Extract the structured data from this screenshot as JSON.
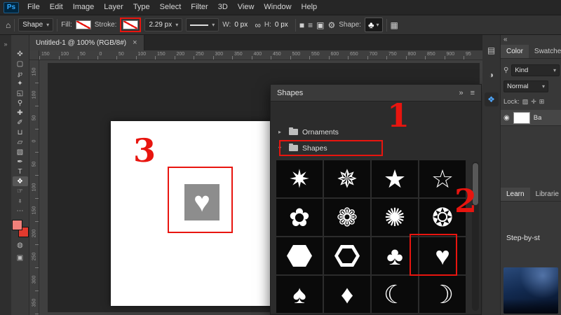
{
  "colors": {
    "annotation_red": "#e8150f",
    "logo_blue": "#31a8ff",
    "panel_active_blue": "#4fa8ff",
    "canvas_shape_gray": "#8d8d8d",
    "foreground_swatch": "#f0807a",
    "background_swatch": "#e23a2e"
  },
  "menu_bar": {
    "logo": "Ps",
    "items": [
      "File",
      "Edit",
      "Image",
      "Layer",
      "Type",
      "Select",
      "Filter",
      "3D",
      "View",
      "Window",
      "Help"
    ]
  },
  "options_bar": {
    "home_icon": "⌂",
    "tool_mode_value": "Shape",
    "chevron": "▾",
    "fill_label": "Fill:",
    "stroke_label": "Stroke:",
    "stroke_width_value": "2.29 px",
    "w_label": "W:",
    "w_value": "0 px",
    "link_icon": "∞",
    "h_label": "H:",
    "h_value": "0 px",
    "path_ops_icon": "■",
    "align_icon": "≡",
    "arrange_icon": "▣",
    "gear_icon": "⚙",
    "shape_label": "Shape:",
    "shape_preview_icon": "♣",
    "extra_icon": "▦"
  },
  "left_dock": {
    "expand_icon": "»"
  },
  "tools": [
    {
      "name": "move-tool",
      "glyph": "✜"
    },
    {
      "name": "rectangular-marquee-tool",
      "glyph": "▢"
    },
    {
      "name": "lasso-tool",
      "glyph": "℘"
    },
    {
      "name": "quick-selection-tool",
      "glyph": "✦"
    },
    {
      "name": "crop-tool",
      "glyph": "◱"
    },
    {
      "name": "eyedropper-tool",
      "glyph": "⚲"
    },
    {
      "name": "spot-healing-brush-tool",
      "glyph": "✚"
    },
    {
      "name": "brush-tool",
      "glyph": "✐"
    },
    {
      "name": "clone-stamp-tool",
      "glyph": "⊔"
    },
    {
      "name": "eraser-tool",
      "glyph": "▱"
    },
    {
      "name": "gradient-tool",
      "glyph": "▧"
    },
    {
      "name": "pen-tool",
      "glyph": "✒"
    },
    {
      "name": "type-tool",
      "glyph": "T"
    },
    {
      "name": "custom-shape-tool",
      "glyph": "❖",
      "active": true
    },
    {
      "name": "hand-tool",
      "glyph": "☞"
    },
    {
      "name": "zoom-tool",
      "glyph": "♁"
    }
  ],
  "toolbar_footer": {
    "more_icon": "⋯",
    "quick_mask_icon": "◍",
    "screen_mode_icon": "▣"
  },
  "document": {
    "tab_title": "Untitled-1 @ 100% (RGB/8#)",
    "close_icon": "×",
    "heart_glyph": "♥"
  },
  "rulers": {
    "horizontal": [
      "150",
      "100",
      "50",
      "0",
      "50",
      "100",
      "150",
      "200",
      "250",
      "300",
      "350",
      "400",
      "450",
      "500",
      "550",
      "600",
      "650",
      "700",
      "750",
      "800",
      "850",
      "900",
      "95"
    ],
    "vertical": [
      "150",
      "100",
      "50",
      "0",
      "50",
      "100",
      "150",
      "200",
      "250",
      "300",
      "350"
    ]
  },
  "shapes_panel": {
    "title": "Shapes",
    "collapse_icon": "»",
    "menu_icon": "≡",
    "folders": [
      {
        "name": "Ornaments",
        "chevron": "▸"
      },
      {
        "name": "Shapes",
        "chevron": "▾"
      }
    ],
    "grid": [
      {
        "name": "shape-10-point-star",
        "glyph": "✷"
      },
      {
        "name": "shape-12-point-star",
        "glyph": "✵"
      },
      {
        "name": "shape-5-point-star",
        "glyph": "★"
      },
      {
        "name": "shape-5-point-star-outline",
        "glyph": "☆"
      },
      {
        "name": "shape-flower",
        "glyph": "✿"
      },
      {
        "name": "shape-flower-outline",
        "glyph": "❁"
      },
      {
        "name": "shape-16-point-burst",
        "glyph": "✺"
      },
      {
        "name": "shape-sun-burst",
        "glyph": "❂"
      },
      {
        "name": "shape-hexagon",
        "css": "hex-solid"
      },
      {
        "name": "shape-hexagon-outline",
        "css": "hex-outline"
      },
      {
        "name": "shape-club",
        "glyph": "♣"
      },
      {
        "name": "shape-heart",
        "glyph": "♥"
      },
      {
        "name": "shape-spade",
        "glyph": "♠"
      },
      {
        "name": "shape-diamond",
        "glyph": "♦"
      },
      {
        "name": "shape-crescent-moon",
        "glyph": "☾"
      },
      {
        "name": "shape-crescent-moon-outline",
        "glyph": "☽"
      }
    ]
  },
  "right_dock": {
    "collapse_icon": "«",
    "panel_icons": [
      {
        "name": "panel-icon-properties",
        "glyph": "▤"
      },
      {
        "name": "panel-icon-adjustments",
        "glyph": "◑"
      },
      {
        "name": "panel-icon-shapes",
        "glyph": "❖",
        "active": true
      }
    ],
    "tabs_top": [
      "Color",
      "Swatche"
    ],
    "layers": {
      "search_icon": "⚲",
      "filter_value": "Kind",
      "blend_value": "Normal",
      "lock_label": "Lock:",
      "lock_icons": [
        "▨",
        "✛",
        "⊞"
      ],
      "eye_icon": "◉",
      "layer_name": "Ba"
    },
    "tabs_bottom": [
      "Learn",
      "Librarie"
    ],
    "learn": {
      "heading": "Step-by-st"
    }
  },
  "annotations": {
    "step1": "1",
    "step2": "2",
    "step3": "3"
  }
}
